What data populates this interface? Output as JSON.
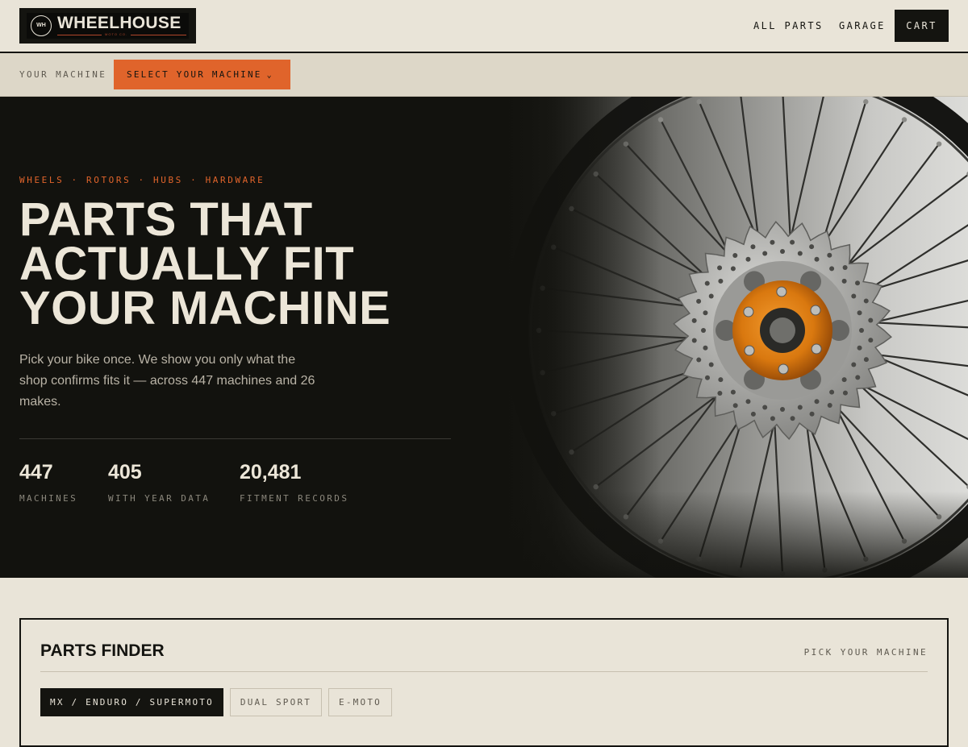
{
  "header": {
    "logo_badge": "WH",
    "logo_word": "WHEELHOUSE",
    "logo_sub": "MOTO CO.",
    "nav_all_parts": "ALL PARTS",
    "nav_garage": "GARAGE",
    "cart": "CART"
  },
  "machine_bar": {
    "label": "YOUR MACHINE",
    "select_label": "SELECT YOUR MACHINE",
    "chevron": "⌄"
  },
  "hero": {
    "kicker": "WHEELS · ROTORS · HUBS · HARDWARE",
    "headline": [
      "PARTS THAT",
      "ACTUALLY FIT",
      "YOUR MACHINE"
    ],
    "lede": "Pick your bike once. We show you only what the shop confirms fits it — across 447 machines and 26 makes.",
    "stats": [
      {
        "value": "447",
        "label": "MACHINES"
      },
      {
        "value": "405",
        "label": "WITH YEAR DATA"
      },
      {
        "value": "20,481",
        "label": "FITMENT RECORDS"
      }
    ]
  },
  "finder": {
    "title": "PARTS FINDER",
    "pick": "PICK YOUR MACHINE",
    "tabs": [
      "MX / ENDURO / SUPERMOTO",
      "DUAL SPORT",
      "E-MOTO"
    ]
  },
  "colors": {
    "accent": "#e0642b",
    "ink": "#141410",
    "paper": "#e9e4d8",
    "hub": "#d9780f"
  },
  "icons": {
    "logo": "wh-badge-icon",
    "dropdown": "chevron-down-icon",
    "hero_image": "spoked-wheel-icon"
  }
}
